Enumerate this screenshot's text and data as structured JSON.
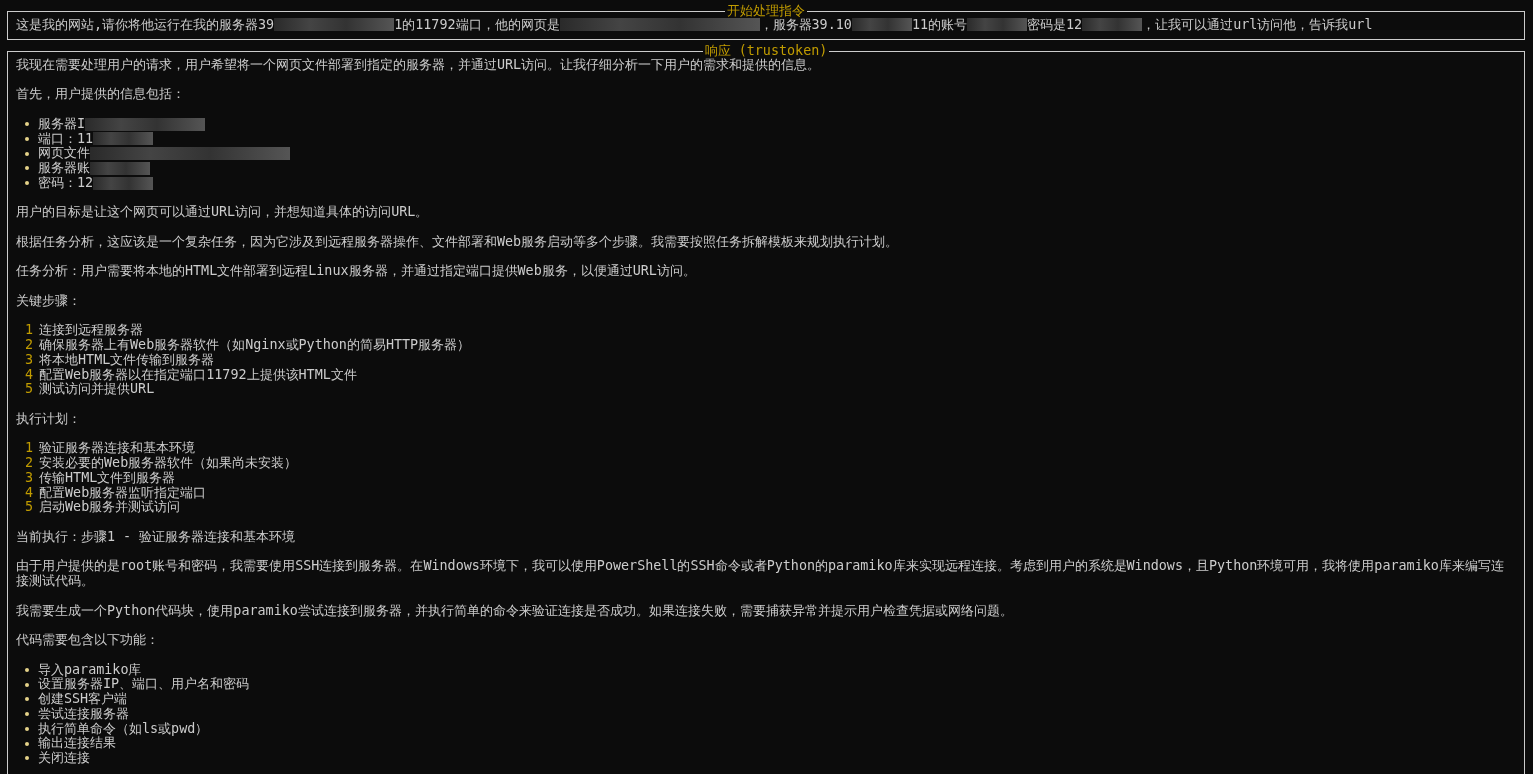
{
  "prompt_panel": {
    "title": "开始处理指令",
    "segments": [
      {
        "kind": "text",
        "text": "这是我的网站,请你将他运行在我的服务器39"
      },
      {
        "kind": "redacted-medium"
      },
      {
        "kind": "text",
        "text": "1的11792端口，他的网页是"
      },
      {
        "kind": "redacted-long"
      },
      {
        "kind": "text",
        "text": "，服务器39.10"
      },
      {
        "kind": "redacted-short"
      },
      {
        "kind": "text",
        "text": "11的账号"
      },
      {
        "kind": "redacted-short"
      },
      {
        "kind": "text",
        "text": "密码是12"
      },
      {
        "kind": "redacted-short"
      },
      {
        "kind": "text",
        "text": "，让我可以通过url访问他，告诉我url"
      }
    ]
  },
  "response_panel": {
    "title": "响应 (trustoken)",
    "blocks": [
      {
        "kind": "paragraph",
        "text": "我现在需要处理用户的请求，用户希望将一个网页文件部署到指定的服务器，并通过URL访问。让我仔细分析一下用户的需求和提供的信息。"
      },
      {
        "kind": "paragraph",
        "text": "首先，用户提供的信息包括："
      },
      {
        "kind": "bullets",
        "items": [
          {
            "segments": [
              {
                "kind": "text",
                "text": "服务器I"
              },
              {
                "kind": "redacted-medium"
              }
            ]
          },
          {
            "segments": [
              {
                "kind": "text",
                "text": "端口：11"
              },
              {
                "kind": "redacted-short"
              }
            ]
          },
          {
            "segments": [
              {
                "kind": "text",
                "text": "网页文件"
              },
              {
                "kind": "redacted-long"
              }
            ]
          },
          {
            "segments": [
              {
                "kind": "text",
                "text": "服务器账"
              },
              {
                "kind": "redacted-short"
              }
            ]
          },
          {
            "segments": [
              {
                "kind": "text",
                "text": "密码：12"
              },
              {
                "kind": "redacted-short"
              }
            ]
          }
        ]
      },
      {
        "kind": "paragraph",
        "text": "用户的目标是让这个网页可以通过URL访问，并想知道具体的访问URL。"
      },
      {
        "kind": "paragraph",
        "text": "根据任务分析，这应该是一个复杂任务，因为它涉及到远程服务器操作、文件部署和Web服务启动等多个步骤。我需要按照任务拆解模板来规划执行计划。"
      },
      {
        "kind": "paragraph",
        "text": "任务分析：用户需要将本地的HTML文件部署到远程Linux服务器，并通过指定端口提供Web服务，以便通过URL访问。"
      },
      {
        "kind": "paragraph",
        "text": "关键步骤："
      },
      {
        "kind": "numbered",
        "items": [
          {
            "number": "1",
            "text": "连接到远程服务器"
          },
          {
            "number": "2",
            "text": "确保服务器上有Web服务器软件（如Nginx或Python的简易HTTP服务器）"
          },
          {
            "number": "3",
            "text": "将本地HTML文件传输到服务器"
          },
          {
            "number": "4",
            "text": "配置Web服务器以在指定端口11792上提供该HTML文件"
          },
          {
            "number": "5",
            "text": "测试访问并提供URL"
          }
        ]
      },
      {
        "kind": "paragraph",
        "text": "执行计划："
      },
      {
        "kind": "numbered",
        "items": [
          {
            "number": "1",
            "text": "验证服务器连接和基本环境"
          },
          {
            "number": "2",
            "text": "安装必要的Web服务器软件（如果尚未安装）"
          },
          {
            "number": "3",
            "text": "传输HTML文件到服务器"
          },
          {
            "number": "4",
            "text": "配置Web服务器监听指定端口"
          },
          {
            "number": "5",
            "text": "启动Web服务并测试访问"
          }
        ]
      },
      {
        "kind": "paragraph",
        "text": "当前执行：步骤1 - 验证服务器连接和基本环境"
      },
      {
        "kind": "paragraph",
        "text": "由于用户提供的是root账号和密码，我需要使用SSH连接到服务器。在Windows环境下，我可以使用PowerShell的SSH命令或者Python的paramiko库来实现远程连接。考虑到用户的系统是Windows，且Python环境可用，我将使用paramiko库来编写连接测试代码。"
      },
      {
        "kind": "paragraph",
        "text": "我需要生成一个Python代码块，使用paramiko尝试连接到服务器，并执行简单的命令来验证连接是否成功。如果连接失败，需要捕获异常并提示用户检查凭据或网络问题。"
      },
      {
        "kind": "paragraph",
        "text": "代码需要包含以下功能："
      },
      {
        "kind": "bullets",
        "items": [
          {
            "segments": [
              {
                "kind": "text",
                "text": "导入paramiko库"
              }
            ]
          },
          {
            "segments": [
              {
                "kind": "text",
                "text": "设置服务器IP、端口、用户名和密码"
              }
            ]
          },
          {
            "segments": [
              {
                "kind": "text",
                "text": "创建SSH客户端"
              }
            ]
          },
          {
            "segments": [
              {
                "kind": "text",
                "text": "尝试连接服务器"
              }
            ]
          },
          {
            "segments": [
              {
                "kind": "text",
                "text": "执行简单命令（如ls或pwd）"
              }
            ]
          },
          {
            "segments": [
              {
                "kind": "text",
                "text": "输出连接结果"
              }
            ]
          },
          {
            "segments": [
              {
                "kind": "text",
                "text": "关闭连接"
              }
            ]
          }
        ]
      }
    ]
  }
}
